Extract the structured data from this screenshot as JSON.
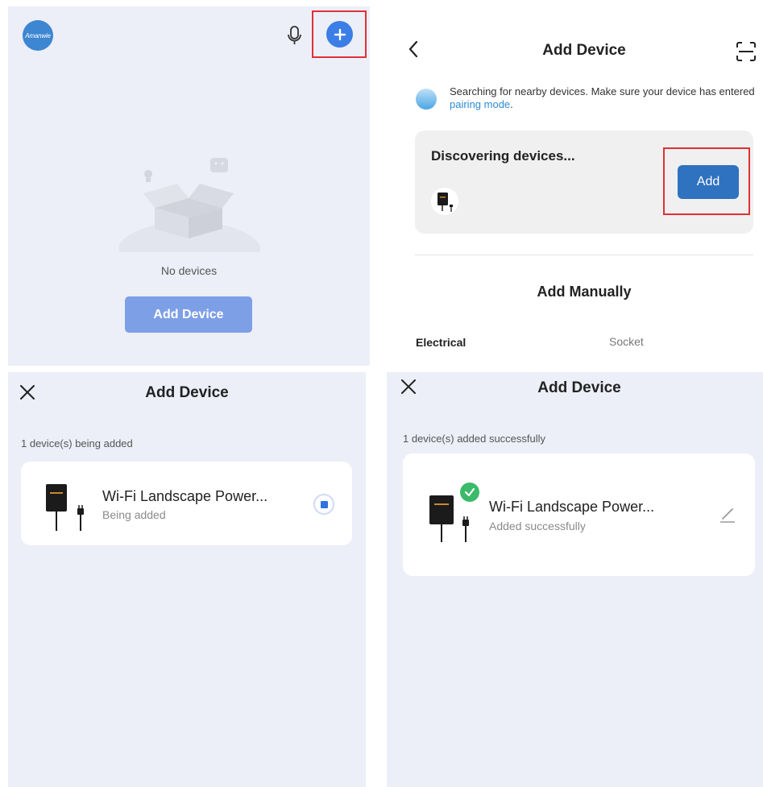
{
  "screen1": {
    "logo_text": "Amanwie",
    "empty_text": "No devices",
    "add_device_label": "Add Device"
  },
  "screen2": {
    "title": "Add Device",
    "search_message": "Searching for nearby devices. Make sure your device has entered ",
    "pairing_link": "pairing mode",
    "search_period": ".",
    "discovering_title": "Discovering devices...",
    "add_label": "Add",
    "add_manually_title": "Add Manually",
    "tabs": [
      "Electrical",
      "Socket"
    ]
  },
  "screen3": {
    "title": "Add Device",
    "status": "1 device(s) being added",
    "device_name": "Wi-Fi Landscape Power...",
    "device_status": "Being added"
  },
  "screen4": {
    "title": "Add Device",
    "status": "1 device(s) added successfully",
    "device_name": "Wi-Fi Landscape Power...",
    "device_status": "Added successfully"
  },
  "colors": {
    "accent_blue": "#3a7ee6",
    "add_button_blue": "#2f72bf",
    "highlight_red": "#e03036",
    "success_green": "#3aba6a",
    "link_blue": "#2d8bd8"
  }
}
